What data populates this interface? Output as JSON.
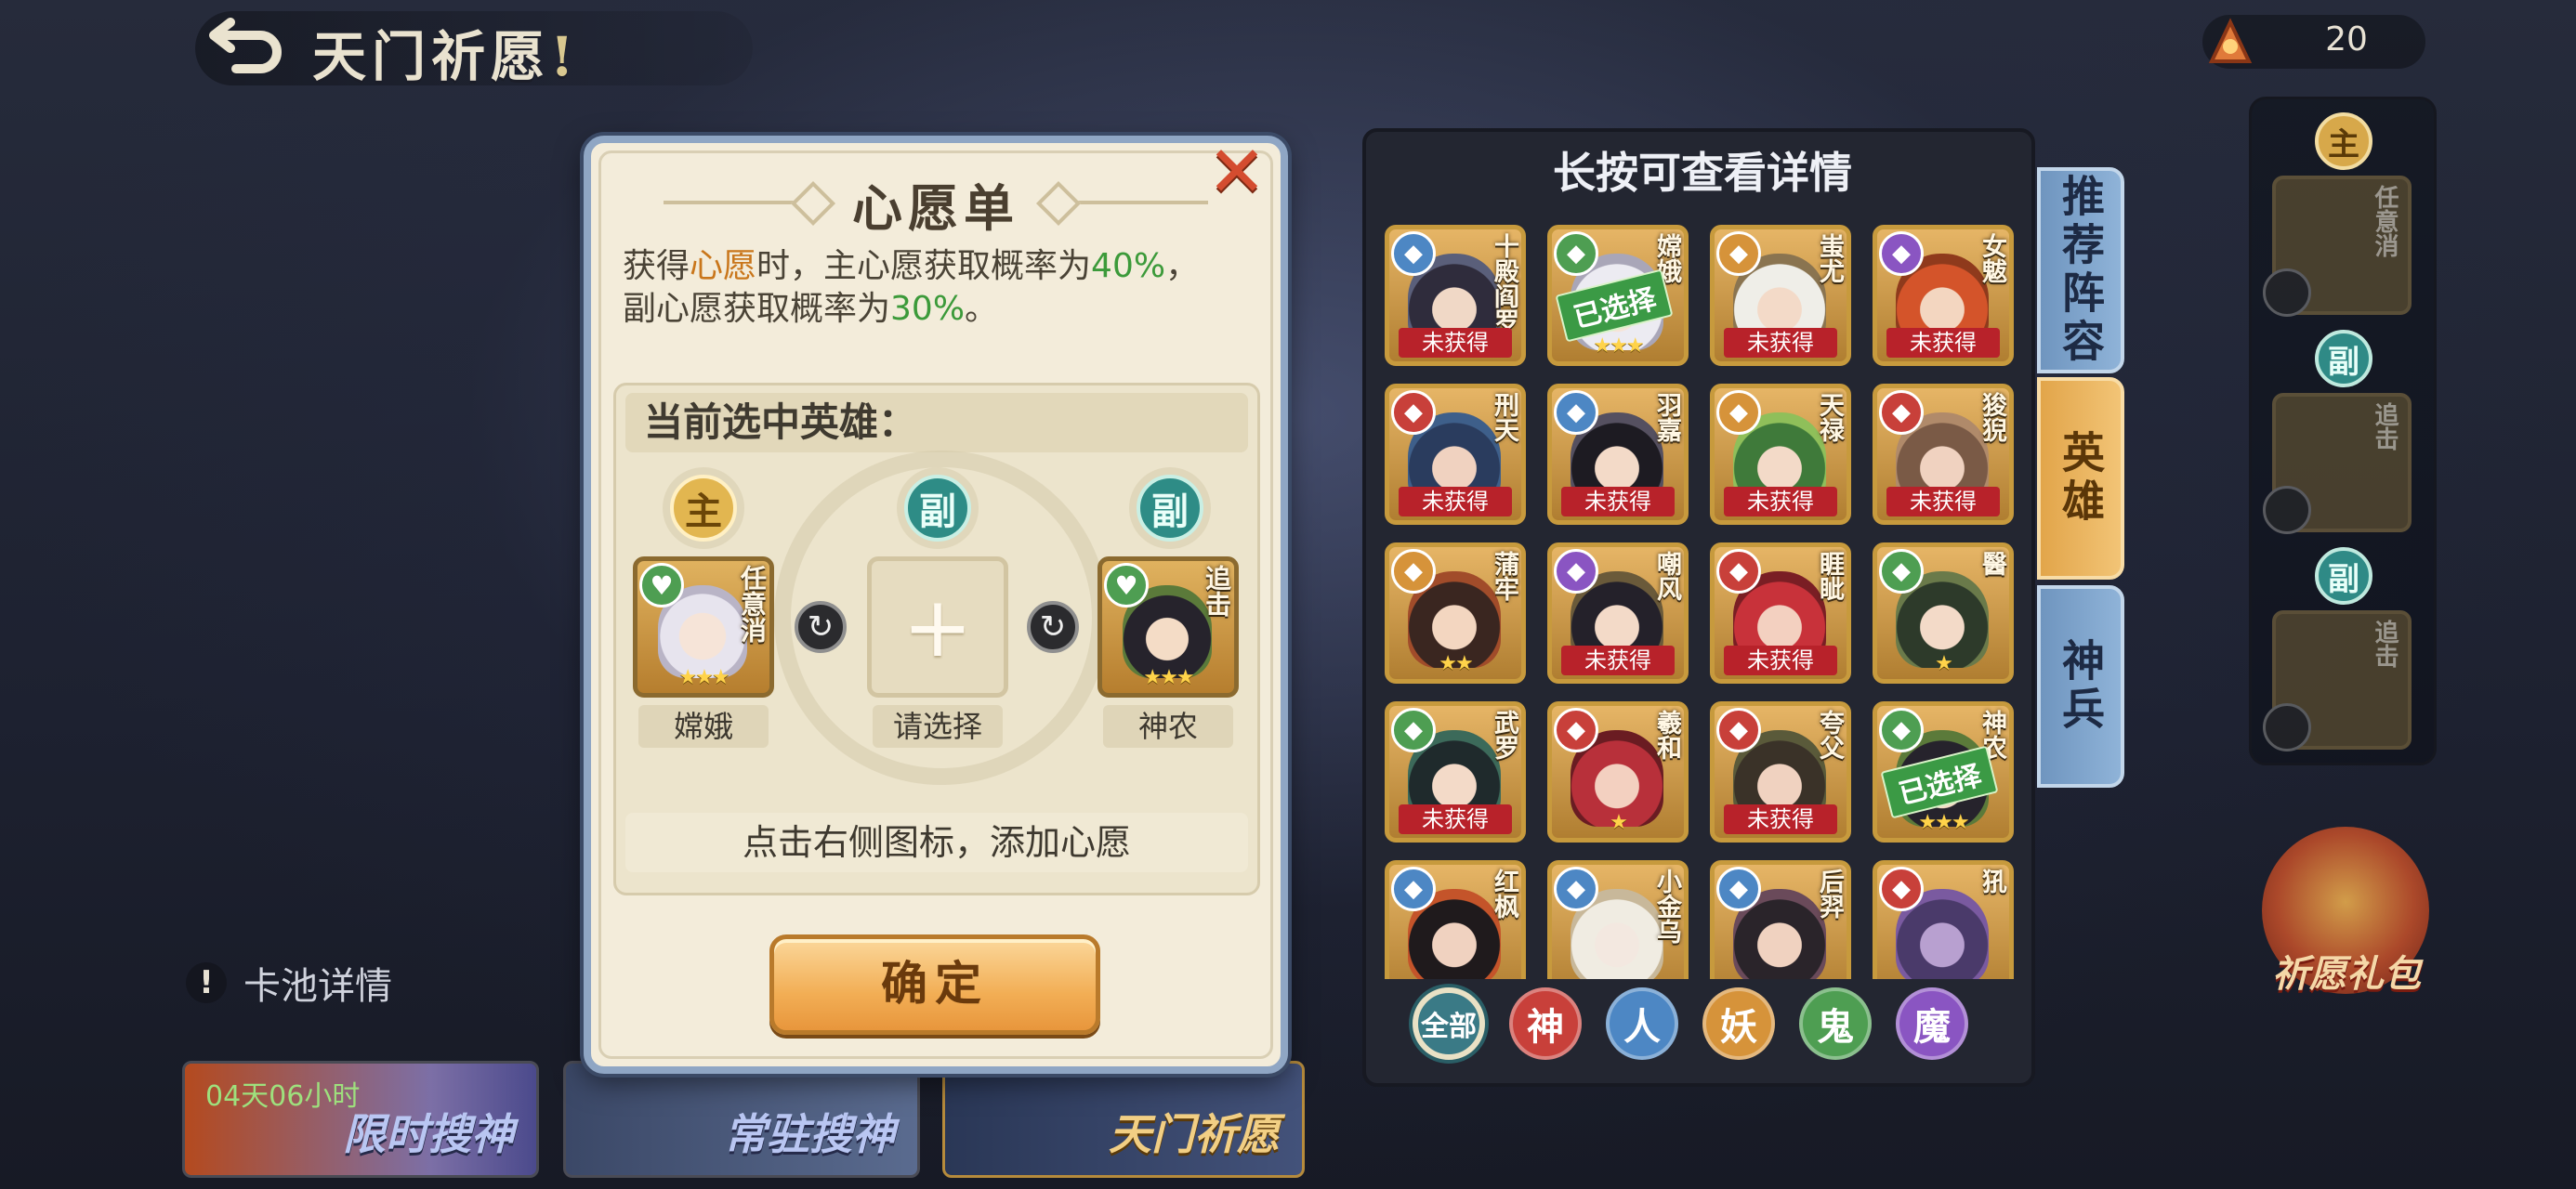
{
  "header": {
    "title": "天门祈愿",
    "title_mark": "!",
    "currency_value": "20"
  },
  "right_slots": {
    "main_badge": "主",
    "sub_badge": "副",
    "cards": [
      "任意消",
      "追击",
      "追击"
    ]
  },
  "pool_detail": {
    "icon": "!",
    "label": "卡池详情"
  },
  "bottom_tabs": [
    {
      "label": "限时搜神",
      "timer": "04天06小时"
    },
    {
      "label": "常驻搜神"
    },
    {
      "label": "天门祈愿"
    }
  ],
  "lantern_label": "祈愿礼包",
  "modal": {
    "title": "心愿单",
    "close_icon": "✕",
    "desc": {
      "p1": "获得",
      "p1_or": "心愿",
      "p1_b": "时，主心愿获取概率为",
      "p1_pct": "40%",
      "p1_end": "，",
      "p2": "副心愿获取概率为",
      "p2_pct": "30%",
      "p2_end": "。"
    },
    "selected_title": "当前选中英雄：",
    "main_badge": "主",
    "sub_badge": "副",
    "slots": [
      {
        "name": "嫦娥",
        "skill": "任意消",
        "stars": "★★★"
      },
      {
        "name": "请选择",
        "plus": "+"
      },
      {
        "name": "神农",
        "skill": "追击",
        "stars": "★★★"
      }
    ],
    "hint": "点击右侧图标，添加心愿",
    "confirm": "确定"
  },
  "picker": {
    "title": "长按可查看详情",
    "status_unowned": "未获得",
    "status_selected": "已选择",
    "heroes": [
      {
        "name": "十殿阎罗",
        "elem": "人",
        "status": "未获得"
      },
      {
        "name": "嫦娥",
        "elem": "鬼",
        "status": "已选择",
        "stars": "★★★"
      },
      {
        "name": "蚩尤",
        "elem": "妖",
        "status": "未获得"
      },
      {
        "name": "女魃",
        "elem": "魔",
        "status": "未获得"
      },
      {
        "name": "刑天",
        "elem": "神",
        "status": "未获得"
      },
      {
        "name": "羽嘉",
        "elem": "人",
        "status": "未获得"
      },
      {
        "name": "天禄",
        "elem": "妖",
        "status": "未获得"
      },
      {
        "name": "狻猊",
        "elem": "神",
        "status": "未获得"
      },
      {
        "name": "蒲牢",
        "elem": "妖",
        "stars": "★★"
      },
      {
        "name": "嘲风",
        "elem": "魔",
        "status": "未获得"
      },
      {
        "name": "睚眦",
        "elem": "神",
        "status": "未获得"
      },
      {
        "name": "醫",
        "elem": "鬼",
        "stars": "★"
      },
      {
        "name": "武罗",
        "elem": "鬼",
        "status": "未获得"
      },
      {
        "name": "羲和",
        "elem": "神",
        "stars": "★"
      },
      {
        "name": "夸父",
        "elem": "神",
        "status": "未获得"
      },
      {
        "name": "神农",
        "elem": "鬼",
        "status": "已选择",
        "stars": "★★★"
      },
      {
        "name": "红枫",
        "elem": "人"
      },
      {
        "name": "小金乌",
        "elem": "人"
      },
      {
        "name": "后羿",
        "elem": "人"
      },
      {
        "name": "犼",
        "elem": "神"
      }
    ],
    "filters": [
      "全部",
      "神",
      "人",
      "妖",
      "鬼",
      "魔"
    ]
  },
  "side_tabs": [
    "推荐阵容",
    "英雄",
    "神兵"
  ],
  "colors": {
    "神": "#c8403a",
    "人": "#4d87c4",
    "妖": "#d6933a",
    "鬼": "#4e9e52",
    "魔": "#8a55c2"
  }
}
